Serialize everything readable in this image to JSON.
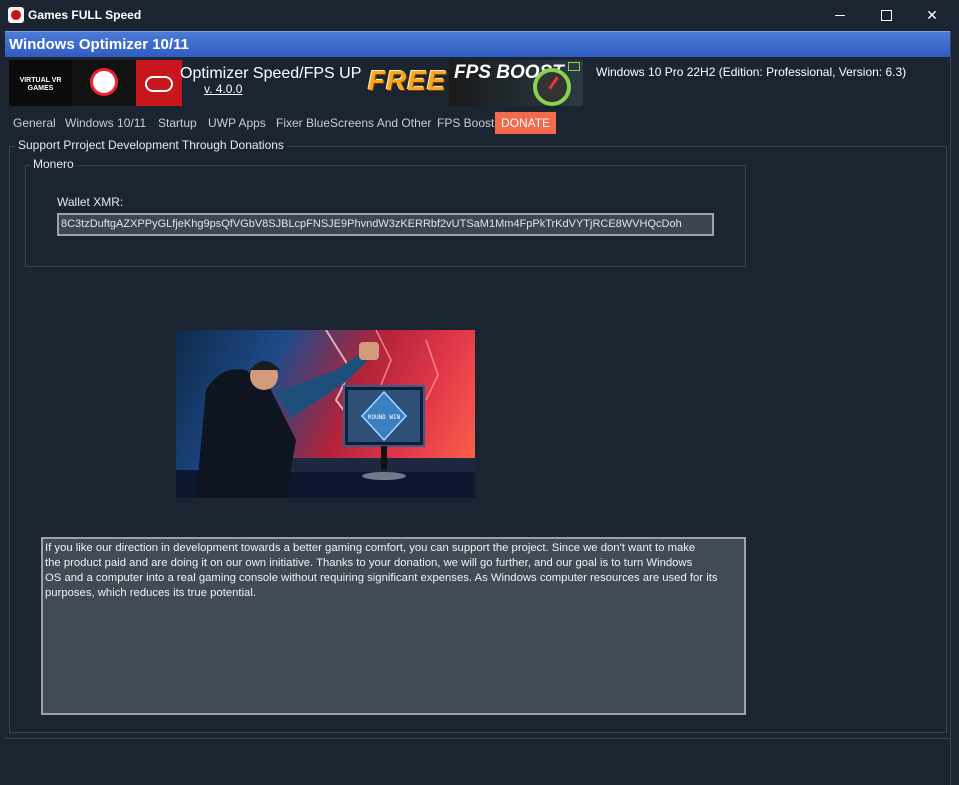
{
  "window": {
    "title": "Games FULL Speed",
    "minimize_glyph": "",
    "maximize_glyph": "",
    "close_glyph": "✕"
  },
  "header": {
    "title": "Windows Optimizer 10/11"
  },
  "banner": {
    "vr_logo_text": "VIRTUAL VR GAMES",
    "product_title": "Optimizer Speed/FPS  UP",
    "version": "v. 4.0.0",
    "free_label": "FREE",
    "fps_boost_label": "FPS BOOST",
    "os_info": "Windows 10 Pro 22H2 (Edition: Professional, Version: 6.3)"
  },
  "tabs": [
    {
      "label": "General"
    },
    {
      "label": "Windows 10/11"
    },
    {
      "label": "Startup"
    },
    {
      "label": "UWP Apps"
    },
    {
      "label": "Fixer BlueScreens And Other"
    },
    {
      "label": "FPS Boost"
    },
    {
      "label": "DONATE",
      "active": true
    }
  ],
  "donate": {
    "group_label": "Support Prroject Development Through Donations",
    "monero_label": "Monero",
    "wallet_label": "Wallet XMR:",
    "wallet_value": "8C3tzDuftgAZXPPyGLfjeKhg9psQfVGbV8SJBLcpFNSJE9PhvndW3zKERRbf2vUTSaM1Mm4FpPkTrKdVYTjRCE8WVHQcDoh",
    "description": "If you like our direction in development towards a better gaming comfort, you can support the project. Since we don't want to make\nthe product paid and are doing it on our own initiative. Thanks to your donation, we will go further, and our goal is to turn Windows\nOS and a computer into a real gaming console without requiring significant expenses. As Windows computer resources are used for its purposes, which reduces its true potential.",
    "monitor_text": "ROUND WIN"
  },
  "colors": {
    "background": "#1b2532",
    "header_blue": "#3a67cc",
    "active_tab": "#f26a4b",
    "free_orange": "#f5a623"
  }
}
